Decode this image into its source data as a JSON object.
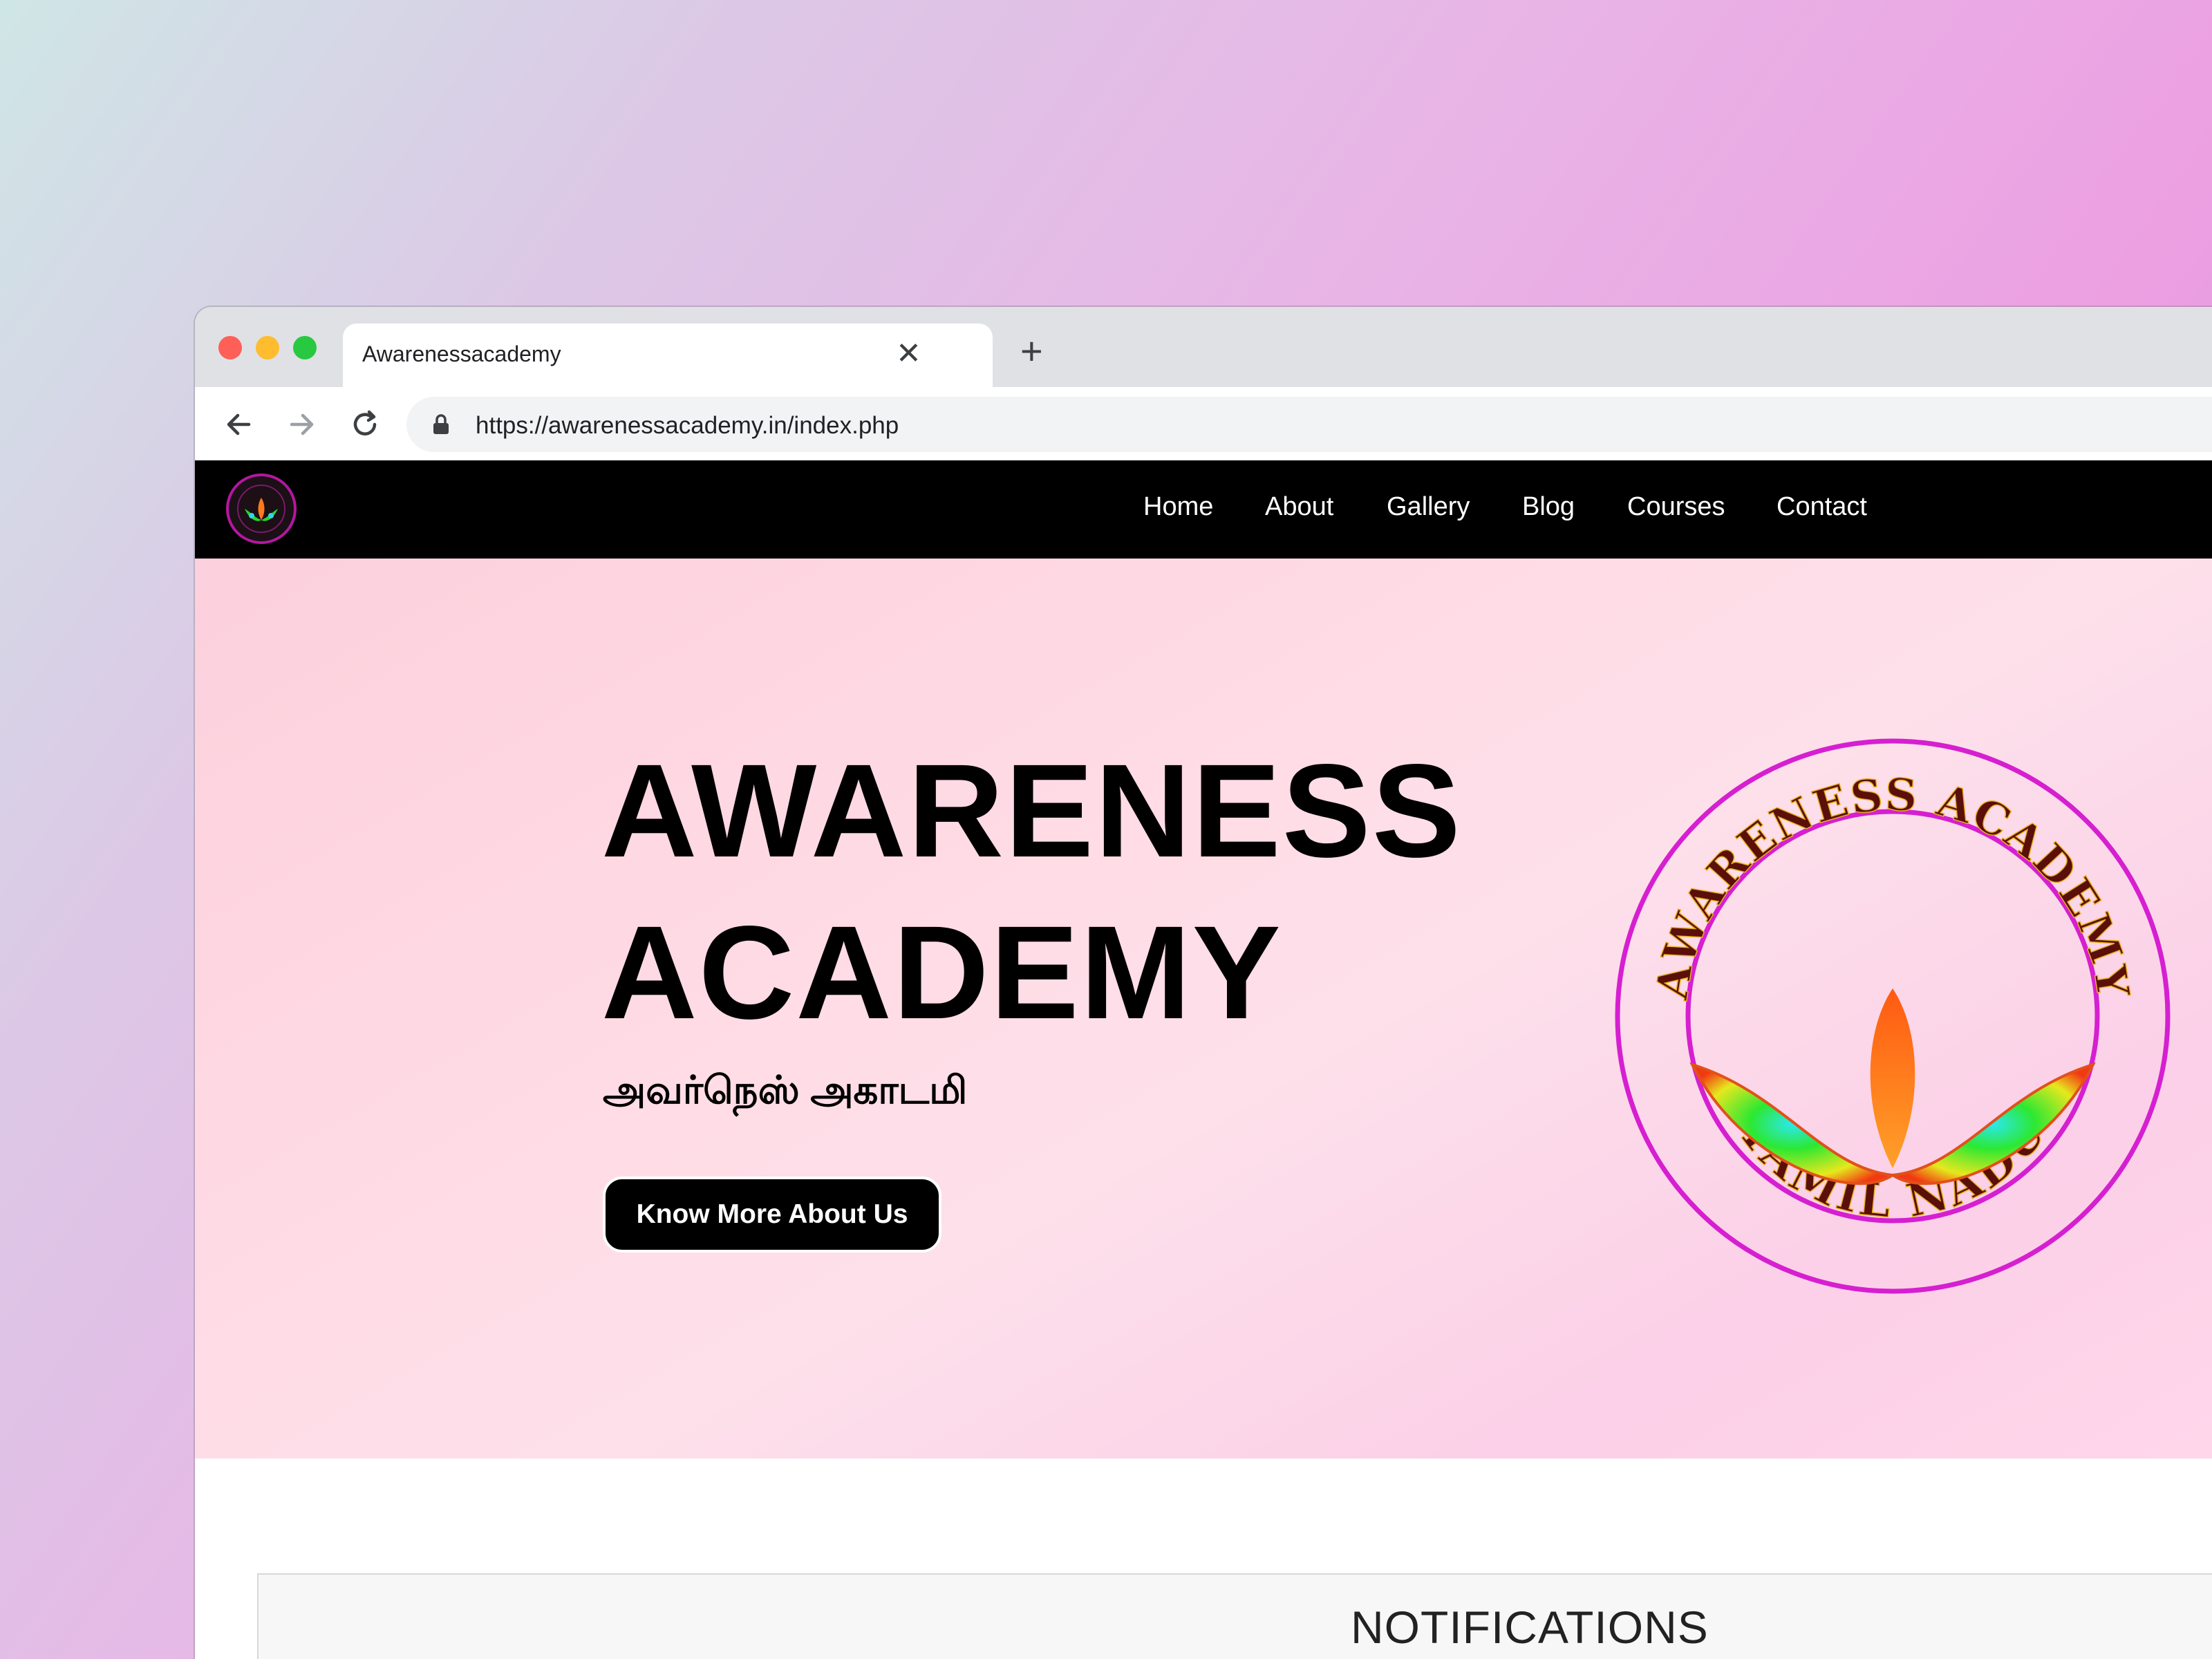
{
  "browser": {
    "tab_title": "Awarenessacademy",
    "tab_close": "✕",
    "new_tab": "+",
    "url": "https://awarenessacademy.in/index.php"
  },
  "nav": {
    "links": [
      "Home",
      "About",
      "Gallery",
      "Blog",
      "Courses",
      "Contact"
    ]
  },
  "hero": {
    "title_line1": "AWARENESS",
    "title_line2": "ACADEMY",
    "subtitle": "அவர்நெஸ் அகாடமி",
    "button_label": "Know More About Us",
    "logo_text_top": "AWARENESS ACADEMY",
    "logo_text_bottom": "TAMIL NADU"
  },
  "notifications": {
    "title": "NOTIFICATIONS"
  },
  "colors": {
    "nav_bg": "#000000",
    "logo_ring": "#d61fd0",
    "logo_text": "#5a0f0a",
    "flame": "#ff7a1a"
  }
}
